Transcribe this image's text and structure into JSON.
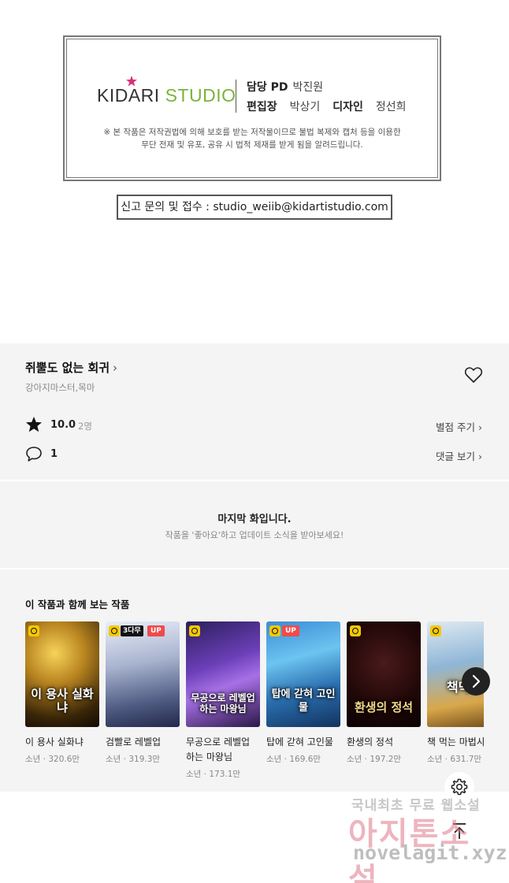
{
  "credits": {
    "logo_kid": "KIDARI",
    "logo_studio": "STUDIO",
    "pd_role": "담당 PD",
    "pd_name": "박진원",
    "editor_role": "편집장",
    "editor_name": "박상기",
    "design_role": "디자인",
    "design_name": "정선희",
    "notice_line1": "※ 본 작품은 저작권법에 의해 보호를 받는 저작물이므로 불법 복제와 캡처 등을 이용한",
    "notice_line2": "무단 전재 및 유포, 공유 시 법적 제재를 받게 됨을 알려드립니다.",
    "contact": "신고 문의 및 접수 : studio_weiib@kidartistudio.com"
  },
  "work": {
    "title": "쥐뿔도 없는 회귀",
    "chevron": "›",
    "authors": "강아지마스터,목마",
    "rating_score": "10.0",
    "rating_count": "2명",
    "rate_link": "별점 주기 ›",
    "comment_count": "1",
    "comment_link": "댓글 보기 ›"
  },
  "last_episode": {
    "title": "마지막 화입니다.",
    "subtitle": "작품을 '좋아요'하고 업데이트 소식을 받아보세요!"
  },
  "recommend": {
    "heading": "이 작품과 함께 보는 작품",
    "items": [
      {
        "name": "이 용사 실화냐",
        "meta": "소년 · 320.6만",
        "cover_text": "이 용사 실화냐",
        "badge3": "",
        "badge_up": ""
      },
      {
        "name": "검빨로 레벨업",
        "meta": "소년 · 319.3만",
        "cover_text": "",
        "badge3": "3다무",
        "badge_up": "UP"
      },
      {
        "name": "무공으로 레벨업 하는 마왕님",
        "meta": "소년 · 173.1만",
        "cover_text": "무공으로 레벨업하는 마왕님",
        "badge3": "",
        "badge_up": ""
      },
      {
        "name": "탑에 갇혀 고인물",
        "meta": "소년 · 169.6만",
        "cover_text": "탑에 갇혀 고인물",
        "badge3": "",
        "badge_up": "UP"
      },
      {
        "name": "환생의 정석",
        "meta": "소년 · 197.2만",
        "cover_text": "환생의 정석",
        "badge3": "",
        "badge_up": ""
      },
      {
        "name": "책 먹는 마법사",
        "meta": "소년 · 631.7만",
        "cover_text": "책먹는",
        "badge3": "",
        "badge_up": ""
      }
    ]
  },
  "watermark": {
    "line1": "국내최초 무료 웹소설",
    "line2": "아지톤소설",
    "line3": "novelagit.xyz"
  },
  "icons": [
    "star-icon",
    "heart-icon",
    "comment-icon",
    "chevron-right-icon",
    "gear-icon",
    "scroll-top-icon",
    "clock-icon"
  ],
  "colors": {
    "brand_green": "#7bb33a",
    "brand_pink": "#d9307a",
    "up_badge": "#f04a4a",
    "clock_badge": "#f5c900"
  }
}
